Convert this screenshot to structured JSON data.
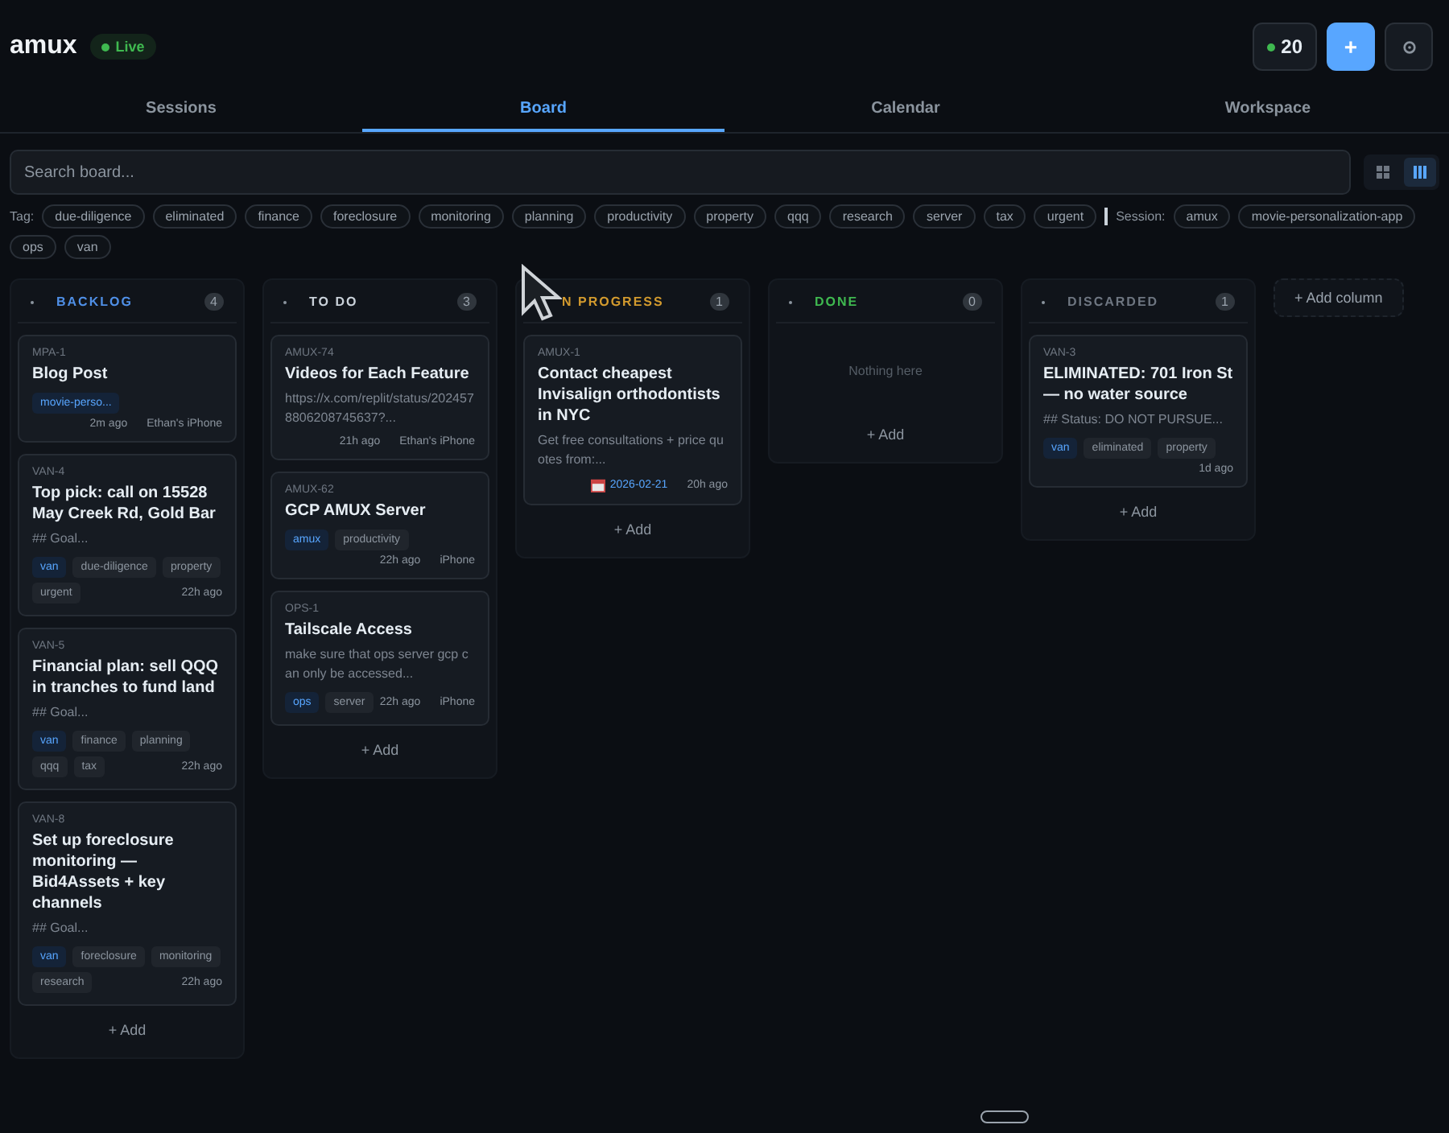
{
  "app": {
    "name": "amux",
    "status": "Live"
  },
  "header": {
    "count": "20",
    "add_button": "+"
  },
  "tabs": [
    {
      "label": "Sessions",
      "selected": false
    },
    {
      "label": "Board",
      "selected": true
    },
    {
      "label": "Calendar",
      "selected": false
    },
    {
      "label": "Workspace",
      "selected": false
    }
  ],
  "search": {
    "placeholder": "Search board..."
  },
  "view_toggle": [
    {
      "selected": false
    },
    {
      "selected": true
    }
  ],
  "filters": {
    "tag_label": "Tag:",
    "tags": [
      "due-diligence",
      "eliminated",
      "finance",
      "foreclosure",
      "monitoring",
      "planning",
      "productivity",
      "property",
      "qqq",
      "research",
      "server",
      "tax",
      "urgent"
    ],
    "session_label": "Session:",
    "sessions": [
      "amux",
      "movie-personalization-app",
      "ops",
      "van"
    ]
  },
  "columns": [
    {
      "title": "BACKLOG",
      "color": "#4f8fe6",
      "count": "4",
      "add": "+ Add",
      "cards": [
        {
          "id": "MPA-1",
          "title": "Blog Post",
          "tags": [
            {
              "label": "movie-perso...",
              "kind": "session"
            }
          ],
          "time": "2m ago",
          "device": "Ethan's iPhone"
        },
        {
          "id": "VAN-4",
          "title": "Top pick: call on 15528 May Creek Rd, Gold Bar",
          "desc": "## Goal...",
          "tags": [
            {
              "label": "van",
              "kind": "session"
            },
            {
              "label": "due-diligence",
              "kind": "tag"
            },
            {
              "label": "property",
              "kind": "tag"
            },
            {
              "label": "urgent",
              "kind": "tag"
            }
          ],
          "time": "22h ago"
        },
        {
          "id": "VAN-5",
          "title": "Financial plan: sell QQQ in tranches to fund land",
          "desc": "## Goal...",
          "tags": [
            {
              "label": "van",
              "kind": "session"
            },
            {
              "label": "finance",
              "kind": "tag"
            },
            {
              "label": "planning",
              "kind": "tag"
            },
            {
              "label": "qqq",
              "kind": "tag"
            },
            {
              "label": "tax",
              "kind": "tag"
            }
          ],
          "time": "22h ago"
        },
        {
          "id": "VAN-8",
          "title": "Set up foreclosure monitoring — Bid4Assets + key channels",
          "desc": "## Goal...",
          "tags": [
            {
              "label": "van",
              "kind": "session"
            },
            {
              "label": "foreclosure",
              "kind": "tag"
            },
            {
              "label": "monitoring",
              "kind": "tag"
            },
            {
              "label": "research",
              "kind": "tag"
            }
          ],
          "time": "22h ago"
        }
      ]
    },
    {
      "title": "TO DO",
      "color": "#c9d1d9",
      "count": "3",
      "add": "+ Add",
      "cards": [
        {
          "id": "AMUX-74",
          "title": "Videos for Each Feature",
          "desc": "https://x.com/replit/status/2024578806208745637?...",
          "time": "21h ago",
          "device": "Ethan's iPhone"
        },
        {
          "id": "AMUX-62",
          "title": "GCP AMUX Server",
          "tags": [
            {
              "label": "amux",
              "kind": "session"
            },
            {
              "label": "productivity",
              "kind": "tag"
            }
          ],
          "time": "22h ago",
          "device": "iPhone"
        },
        {
          "id": "OPS-1",
          "title": "Tailscale Access",
          "desc": "make sure that ops server gcp can only be accessed...",
          "tags": [
            {
              "label": "ops",
              "kind": "session"
            },
            {
              "label": "server",
              "kind": "tag"
            }
          ],
          "time": "22h ago",
          "device": "iPhone"
        }
      ]
    },
    {
      "title": "N PROGRESS",
      "color": "#d29a2e",
      "count": "1",
      "add": "+ Add",
      "cards": [
        {
          "id": "AMUX-1",
          "title": "Contact cheapest Invisalign orthodontists in NYC",
          "desc": "Get free consultations + price quotes from:...",
          "due": "2026-02-21",
          "time": "20h ago"
        }
      ]
    },
    {
      "title": "DONE",
      "color": "#3fb950",
      "count": "0",
      "empty_text": "Nothing here",
      "add": "+ Add"
    },
    {
      "title": "DISCARDED",
      "color": "#6e7681",
      "count": "1",
      "add": "+ Add",
      "cards": [
        {
          "id": "VAN-3",
          "title": "ELIMINATED: 701 Iron St — no water source",
          "desc": "## Status: DO NOT PURSUE...",
          "tags": [
            {
              "label": "van",
              "kind": "session"
            },
            {
              "label": "eliminated",
              "kind": "tag"
            },
            {
              "label": "property",
              "kind": "tag"
            }
          ],
          "time": "1d ago"
        }
      ]
    }
  ],
  "add_column": "+ Add column"
}
